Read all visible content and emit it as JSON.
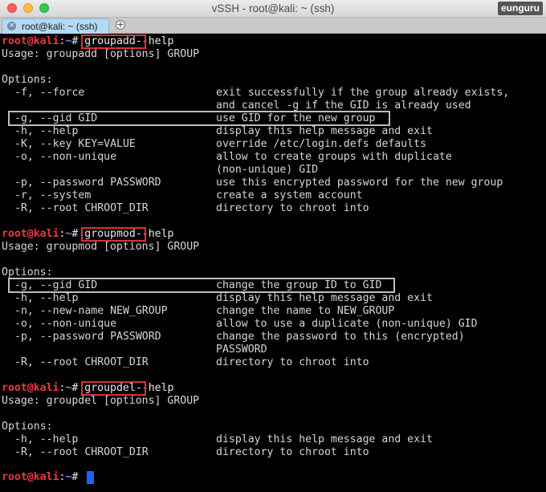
{
  "window": {
    "title": "vSSH - root@kali: ~ (ssh)",
    "user_badge": "eunguru"
  },
  "tab": {
    "label": "root@kali: ~ (ssh)",
    "close_glyph": "×",
    "new_tab_glyph": "+"
  },
  "prompt": {
    "user_host": "root@kali",
    "sep": ":",
    "path": "~",
    "symbol": "#"
  },
  "blocks": {
    "groupadd": {
      "command": "groupadd",
      "args": "--help",
      "usage": "Usage: groupadd [options] GROUP",
      "options_header": "Options:",
      "options": [
        {
          "opt": "-f, --force",
          "desc": "exit successfully if the group already exists,"
        },
        {
          "opt": "",
          "desc": "and cancel -g if the GID is already used"
        },
        {
          "opt": "-g, --gid GID",
          "desc": "use GID for the new group"
        },
        {
          "opt": "-h, --help",
          "desc": "display this help message and exit"
        },
        {
          "opt": "-K, --key KEY=VALUE",
          "desc": "override /etc/login.defs defaults"
        },
        {
          "opt": "-o, --non-unique",
          "desc": "allow to create groups with duplicate"
        },
        {
          "opt": "",
          "desc": "(non-unique) GID"
        },
        {
          "opt": "-p, --password PASSWORD",
          "desc": "use this encrypted password for the new group"
        },
        {
          "opt": "-r, --system",
          "desc": "create a system account"
        },
        {
          "opt": "-R, --root CHROOT_DIR",
          "desc": "directory to chroot into"
        }
      ]
    },
    "groupmod": {
      "command": "groupmod",
      "args": "--help",
      "usage": "Usage: groupmod [options] GROUP",
      "options_header": "Options:",
      "options": [
        {
          "opt": "-g, --gid GID",
          "desc": "change the group ID to GID"
        },
        {
          "opt": "-h, --help",
          "desc": "display this help message and exit"
        },
        {
          "opt": "-n, --new-name NEW_GROUP",
          "desc": "change the name to NEW_GROUP"
        },
        {
          "opt": "-o, --non-unique",
          "desc": "allow to use a duplicate (non-unique) GID"
        },
        {
          "opt": "-p, --password PASSWORD",
          "desc": "change the password to this (encrypted)"
        },
        {
          "opt": "",
          "desc": "PASSWORD"
        },
        {
          "opt": "-R, --root CHROOT_DIR",
          "desc": "directory to chroot into"
        }
      ]
    },
    "groupdel": {
      "command": "groupdel",
      "args": "--help",
      "usage": "Usage: groupdel [options] GROUP",
      "options_header": "Options:",
      "options": [
        {
          "opt": "-h, --help",
          "desc": "display this help message and exit"
        },
        {
          "opt": "-R, --root CHROOT_DIR",
          "desc": "directory to chroot into"
        }
      ]
    }
  },
  "colors": {
    "prompt_user": "#f0363d",
    "prompt_path": "#5a8ff2",
    "highlight_red": "#d8323a",
    "highlight_gray": "#bdbdbd",
    "cursor": "#1f63ff"
  }
}
